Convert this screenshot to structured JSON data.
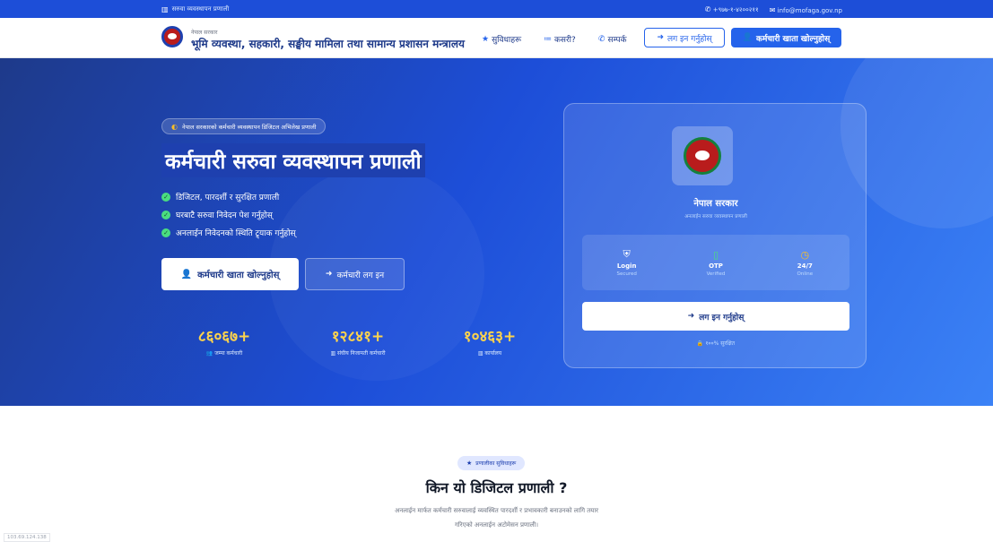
{
  "topbar": {
    "left_text": "सरुवा व्यवस्थापन प्रणाली",
    "phone": "+९७७-१-४२००२११",
    "email": "info@mofaga.gov.np"
  },
  "nav": {
    "brand_small": "नेपाल सरकार",
    "brand_big": "भूमि व्यवस्था, सहकारी, सङ्घीय मामिला तथा सामान्य प्रशासन मन्त्रालय",
    "links": [
      {
        "label": "सुविधाहरू",
        "icon": "star-icon"
      },
      {
        "label": "कसरी?",
        "icon": "list-icon"
      },
      {
        "label": "सम्पर्क",
        "icon": "phone-icon"
      }
    ],
    "login_label": "लग इन गर्नुहोस्",
    "open_account_label": "कर्मचारी खाता खोल्नुहोस्"
  },
  "hero": {
    "pill": "नेपाल सरकारको कर्मचारी व्यवस्थापन डिजिटल अभिलेख प्रणाली",
    "title": "कर्मचारी सरुवा व्यवस्थापन प्रणाली",
    "features": [
      "डिजिटल, पारदर्शी र सुरक्षित प्रणाली",
      "घरबाटै सरुवा निवेदन पेश गर्नुहोस्",
      "अनलाईन निवेदनको स्थिति ट्र्याक गर्नुहोस्"
    ],
    "primary_button": "कर्मचारी खाता खोल्नुहोस्",
    "secondary_button": "कर्मचारी लग इन",
    "stats": [
      {
        "value": "८६०६७+",
        "label": "जम्मा कर्मचारी",
        "icon": "users-icon"
      },
      {
        "value": "१२८४१+",
        "label": "संघीय निजामती कर्मचारी",
        "icon": "building-icon"
      },
      {
        "value": "१०४६३+",
        "label": "कार्यालय",
        "icon": "office-icon"
      }
    ]
  },
  "card": {
    "title": "नेपाल सरकार",
    "subtitle": "अनलाईन सरुवा व्यवस्थापन प्रणाली",
    "features": [
      {
        "title": "Login",
        "sub": "Secured",
        "icon": "shield-icon",
        "color": "#ffffff"
      },
      {
        "title": "OTP",
        "sub": "Verified",
        "icon": "mobile-icon",
        "color": "#4ade80"
      },
      {
        "title": "24/7",
        "sub": "Online",
        "icon": "clock-icon",
        "color": "#fbbf24"
      }
    ],
    "login_button": "लग इन गर्नुहोस्",
    "secure_text": "१००% सुरक्षित"
  },
  "section": {
    "pill": "प्रणालीका सुविधाहरू",
    "title": "किन यो डिजिटल प्रणाली ?",
    "desc_line1": "अनलाईन मार्फत कर्मचारी सरुवालाई व्यवस्थित पारदर्शी र प्रभावकारी बनाउनको लागि तयार",
    "desc_line2": "गरिएको अनलाईन अटोमेसन प्रणाली।"
  },
  "footer_ip": "103.69.124.138"
}
